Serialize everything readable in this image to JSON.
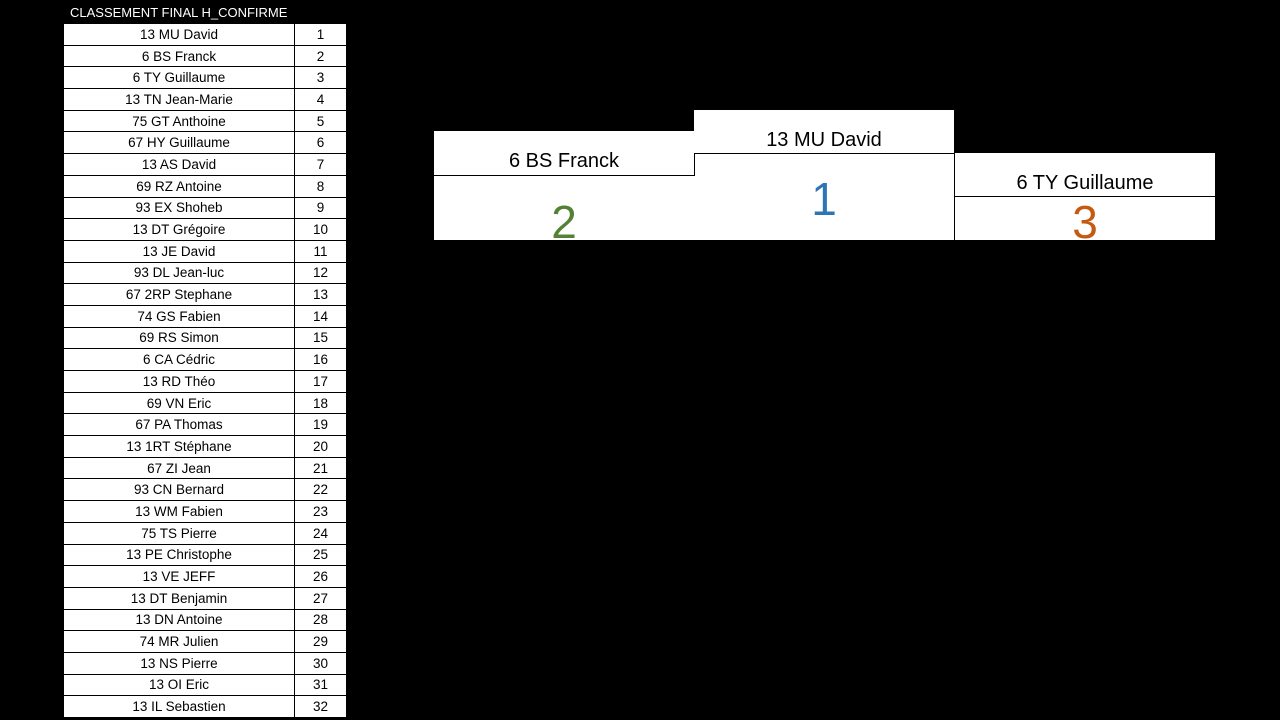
{
  "title": "CLASSEMENT FINAL H_CONFIRME",
  "colors": {
    "background": "#000000",
    "cell": "#ffffff",
    "first": "#2e75b6",
    "second": "#548235",
    "third": "#c55a11"
  },
  "table": {
    "rows": [
      {
        "name": "13 MU David",
        "rank": "1"
      },
      {
        "name": "6 BS Franck",
        "rank": "2"
      },
      {
        "name": "6 TY Guillaume",
        "rank": "3"
      },
      {
        "name": "13 TN Jean-Marie",
        "rank": "4"
      },
      {
        "name": "75 GT Anthoine",
        "rank": "5"
      },
      {
        "name": "67 HY Guillaume",
        "rank": "6"
      },
      {
        "name": "13 AS David",
        "rank": "7"
      },
      {
        "name": "69 RZ Antoine",
        "rank": "8"
      },
      {
        "name": "93 EX Shoheb",
        "rank": "9"
      },
      {
        "name": "13 DT Grégoire",
        "rank": "10"
      },
      {
        "name": "13 JE David",
        "rank": "11"
      },
      {
        "name": "93 DL Jean-luc",
        "rank": "12"
      },
      {
        "name": "67 2RP Stephane",
        "rank": "13"
      },
      {
        "name": "74 GS Fabien",
        "rank": "14"
      },
      {
        "name": "69 RS Simon",
        "rank": "15"
      },
      {
        "name": "6 CA Cédric",
        "rank": "16"
      },
      {
        "name": "13 RD Théo",
        "rank": "17"
      },
      {
        "name": "69 VN Eric",
        "rank": "18"
      },
      {
        "name": "67 PA Thomas",
        "rank": "19"
      },
      {
        "name": "13 1RT Stéphane",
        "rank": "20"
      },
      {
        "name": "67 ZI Jean",
        "rank": "21"
      },
      {
        "name": "93 CN Bernard",
        "rank": "22"
      },
      {
        "name": "13 WM Fabien",
        "rank": "23"
      },
      {
        "name": "75 TS Pierre",
        "rank": "24"
      },
      {
        "name": "13 PE Christophe",
        "rank": "25"
      },
      {
        "name": "13 VE JEFF",
        "rank": "26"
      },
      {
        "name": "13 DT Benjamin",
        "rank": "27"
      },
      {
        "name": "13 DN Antoine",
        "rank": "28"
      },
      {
        "name": "74 MR Julien",
        "rank": "29"
      },
      {
        "name": "13 NS Pierre",
        "rank": "30"
      },
      {
        "name": "13 OI Eric",
        "rank": "31"
      },
      {
        "name": "13 IL Sebastien",
        "rank": "32"
      }
    ]
  },
  "podium": {
    "first": {
      "name": "13 MU David",
      "rank": "1"
    },
    "second": {
      "name": "6 BS Franck",
      "rank": "2"
    },
    "third": {
      "name": "6 TY Guillaume",
      "rank": "3"
    }
  }
}
